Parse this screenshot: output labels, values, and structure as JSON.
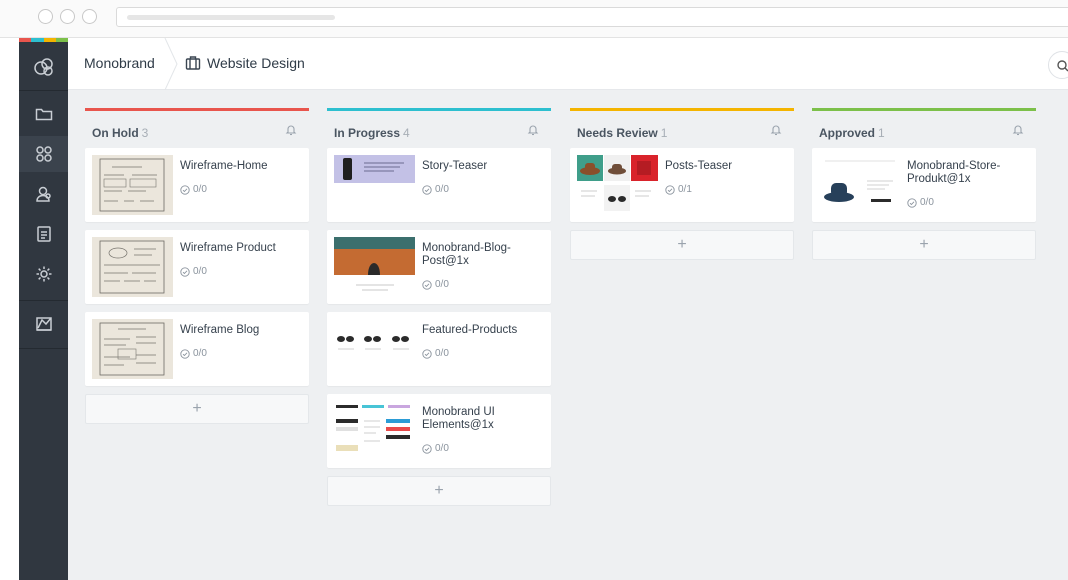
{
  "window": {
    "controls": [
      "close",
      "minimize",
      "maximize"
    ]
  },
  "sidebar": {
    "accent_colors": [
      "#e8554d",
      "#2dbfcf",
      "#f4b400",
      "#7cc04a"
    ],
    "logo_icon": "brand-logo-icon",
    "items": [
      {
        "icon": "folder-icon",
        "active": false
      },
      {
        "icon": "boards-grid-icon",
        "active": true
      },
      {
        "icon": "users-icon",
        "active": false
      },
      {
        "icon": "tasks-icon",
        "active": false
      },
      {
        "icon": "gear-icon",
        "active": false
      },
      {
        "icon": "reports-icon",
        "active": false
      }
    ]
  },
  "header": {
    "breadcrumb": [
      "Monobrand",
      "Website Design"
    ],
    "project_icon": "briefcase-icon",
    "search_icon": "search-icon"
  },
  "columns": [
    {
      "title": "On Hold",
      "count": "3",
      "color": "#e8554d",
      "cards": [
        {
          "title": "Wireframe-Home",
          "meta": "0/0"
        },
        {
          "title": "Wireframe Product",
          "meta": "0/0"
        },
        {
          "title": "Wireframe Blog",
          "meta": "0/0"
        }
      ],
      "add_label": "+"
    },
    {
      "title": "In Progress",
      "count": "4",
      "color": "#2dbfcf",
      "cards": [
        {
          "title": "Story-Teaser",
          "meta": "0/0"
        },
        {
          "title": "Monobrand-Blog-Post@1x",
          "meta": "0/0"
        },
        {
          "title": "Featured-Products",
          "meta": "0/0"
        },
        {
          "title": "Monobrand UI Elements@1x",
          "meta": "0/0"
        }
      ],
      "add_label": "+"
    },
    {
      "title": "Needs Review",
      "count": "1",
      "color": "#f4b400",
      "cards": [
        {
          "title": "Posts-Teaser",
          "meta": "0/1"
        }
      ],
      "add_label": "+"
    },
    {
      "title": "Approved",
      "count": "1",
      "color": "#7cc04a",
      "cards": [
        {
          "title": "Monobrand-Store-Produkt@1x",
          "meta": "0/0"
        }
      ],
      "add_label": "+"
    }
  ]
}
